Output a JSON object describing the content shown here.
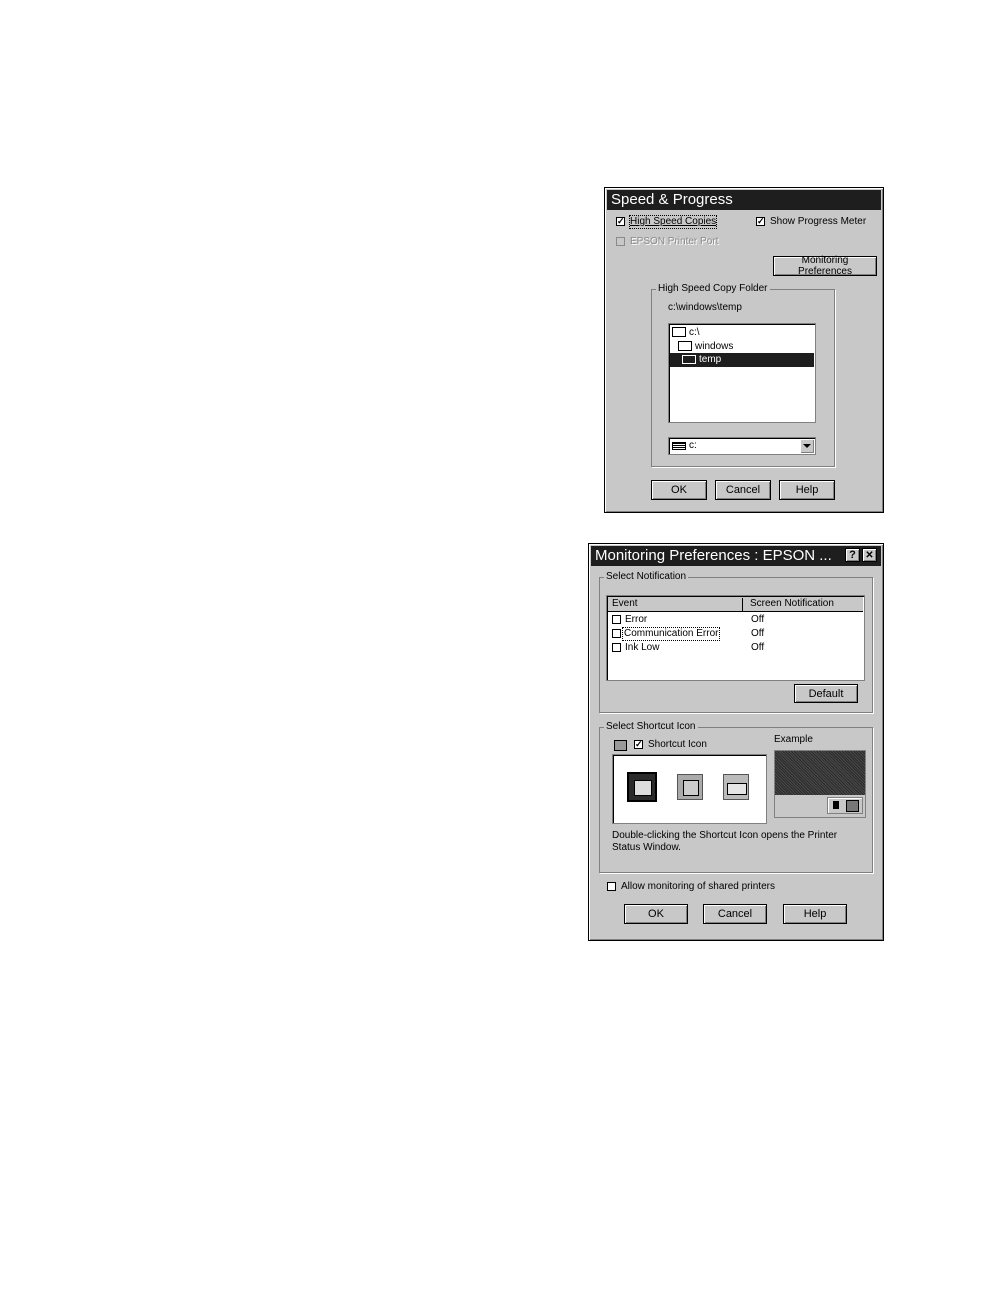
{
  "speed_dialog": {
    "title": "Speed & Progress",
    "high_speed_copies": {
      "label": "High Speed Copies",
      "checked": true
    },
    "show_progress_meter": {
      "label": "Show Progress Meter",
      "checked": true
    },
    "epson_printer_port": {
      "label": "EPSON Printer Port",
      "checked": false,
      "disabled": true
    },
    "monitoring_preferences_button": "Monitoring Preferences",
    "folder_group_title": "High Speed Copy Folder",
    "current_path": "c:\\windows\\temp",
    "folder_tree": [
      {
        "label": "c:\\",
        "icon": "folder-open-icon",
        "selected": false
      },
      {
        "label": "windows",
        "icon": "folder-open-icon",
        "selected": false
      },
      {
        "label": "temp",
        "icon": "folder-open-icon",
        "selected": true
      }
    ],
    "drive_select": {
      "value": "c:",
      "icon": "drive-icon"
    },
    "ok_button": "OK",
    "cancel_button": "Cancel",
    "help_button": "Help"
  },
  "monitoring_dialog": {
    "title": "Monitoring Preferences : EPSON ...",
    "help_icon": "?",
    "close_icon": "✕",
    "select_notification_title": "Select Notification",
    "table": {
      "headers": [
        "Event",
        "Screen Notification"
      ],
      "rows": [
        {
          "event": "Error",
          "notification": "Off",
          "checked": false
        },
        {
          "event": "Communication Error",
          "notification": "Off",
          "checked": false
        },
        {
          "event": "Ink Low",
          "notification": "Off",
          "checked": false
        }
      ]
    },
    "default_button": "Default",
    "select_shortcut_title": "Select Shortcut Icon",
    "shortcut_icon": {
      "label": "Shortcut Icon",
      "checked": true
    },
    "example_label": "Example",
    "icons": [
      "printer-icon",
      "printer-box-icon",
      "printer-side-icon"
    ],
    "description": "Double-clicking the Shortcut Icon opens the Printer Status Window.",
    "allow_shared": {
      "label": "Allow monitoring of shared printers",
      "checked": false
    },
    "ok_button": "OK",
    "cancel_button": "Cancel",
    "help_button": "Help"
  }
}
